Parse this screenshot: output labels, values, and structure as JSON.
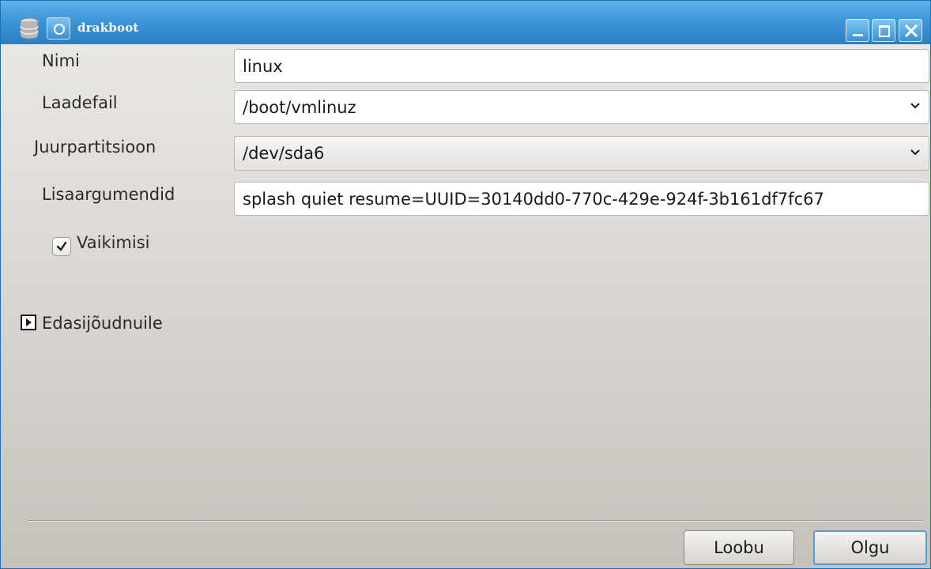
{
  "window": {
    "title": "drakboot",
    "accent_color": "#3b93d6"
  },
  "titlebar": {
    "app_icon": "disk-drive-icon",
    "menu_icon": "window-menu-icon",
    "buttons": [
      "minimize-icon",
      "maximize-icon",
      "close-icon"
    ]
  },
  "form": {
    "name_label": "Nimi",
    "name_value": "linux",
    "image_label": "Laadefail",
    "image_value": "/boot/vmlinuz",
    "root_label": "Juurpartitsioon",
    "root_value": "/dev/sda6",
    "append_label": "Lisaargumendid",
    "append_value": "splash quiet resume=UUID=30140dd0-770c-429e-924f-3b161df7fc67",
    "default_label": "Vaikimisi",
    "default_checked": true
  },
  "advanced": {
    "label": "Edasijõudnuile",
    "expanded": false
  },
  "footer": {
    "cancel_label": "Loobu",
    "ok_label": "Olgu"
  }
}
